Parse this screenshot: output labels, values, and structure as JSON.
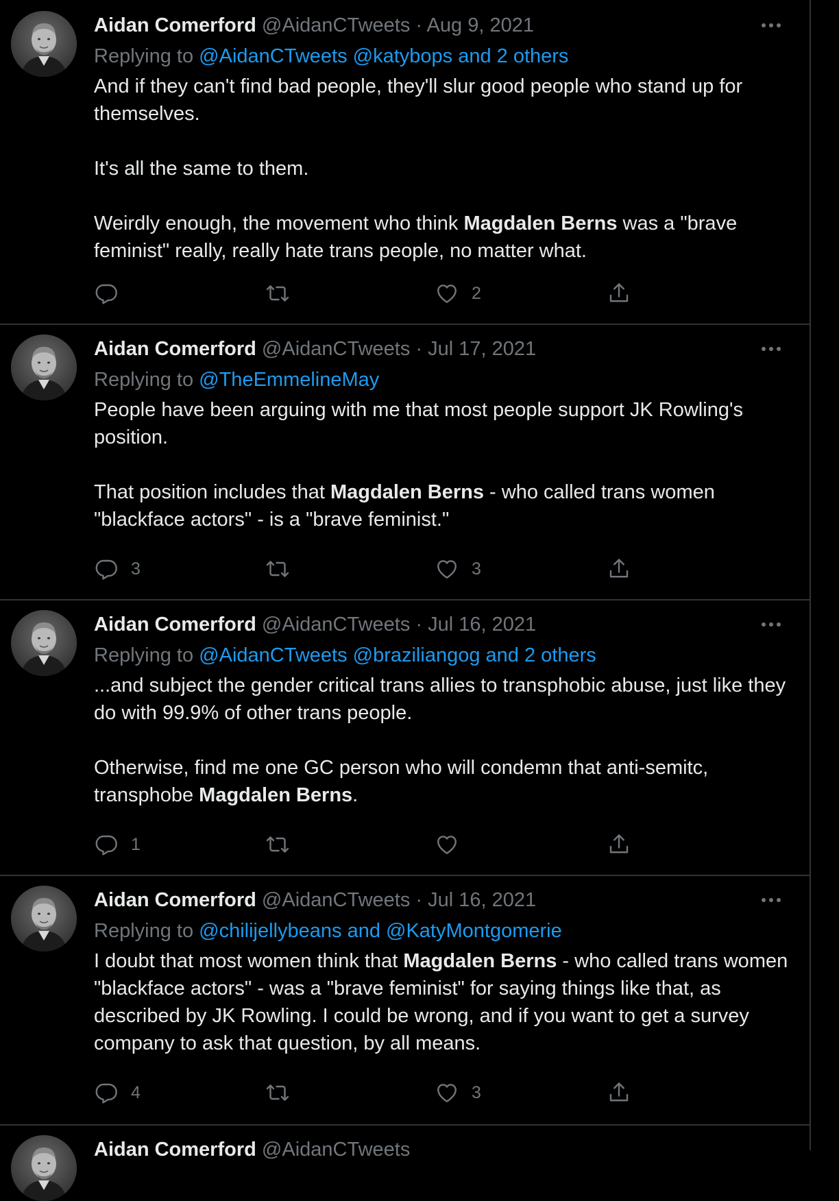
{
  "author": {
    "name": "Aidan Comerford",
    "handle": "@AidanCTweets"
  },
  "separator": "·",
  "replying_prefix": "Replying to",
  "tweets": [
    {
      "date": "Aug 9, 2021",
      "replying_to": "@AidanCTweets @katybops and 2 others",
      "paragraphs": [
        [
          "And if they can't find bad people, they'll slur good people who stand up for themselves."
        ],
        [
          "It's all the same to them."
        ],
        [
          "Weirdly enough, the movement who think ",
          "Magdalen Berns",
          " was a \"brave feminist\" really, really hate trans people, no matter what."
        ]
      ],
      "replies": "",
      "retweets": "",
      "likes": "2"
    },
    {
      "date": "Jul 17, 2021",
      "replying_to": "@TheEmmelineMay",
      "paragraphs": [
        [
          "People have been arguing with me that most people support JK Rowling's position."
        ],
        [
          "That position includes that ",
          "Magdalen Berns",
          " - who called trans women \"blackface actors\" - is a \"brave feminist.\""
        ]
      ],
      "replies": "3",
      "retweets": "",
      "likes": "3"
    },
    {
      "date": "Jul 16, 2021",
      "replying_to": "@AidanCTweets @braziliangog and 2 others",
      "paragraphs": [
        [
          "...and subject the gender critical trans allies to transphobic abuse, just like they do with 99.9% of other trans people."
        ],
        [
          "Otherwise, find me one GC person  who will condemn that anti-semitc, transphobe ",
          "Magdalen Berns",
          "."
        ]
      ],
      "replies": "1",
      "retweets": "",
      "likes": ""
    },
    {
      "date": "Jul 16, 2021",
      "replying_to": "@chilijellybeans and @KatyMontgomerie",
      "paragraphs": [
        [
          "I doubt that most women think that ",
          "Magdalen Berns",
          " - who called trans women \"blackface actors\" - was a \"brave feminist\" for saying things like that, as described by JK Rowling. I could be wrong, and if you want to get a survey company to ask that question, by all means."
        ]
      ],
      "replies": "4",
      "retweets": "",
      "likes": "3"
    }
  ],
  "icons": {
    "reply": "reply-icon",
    "retweet": "retweet-icon",
    "like": "heart-icon",
    "share": "share-icon",
    "more": "more-icon"
  },
  "colors": {
    "background": "#000000",
    "text": "#e7e9ea",
    "muted": "#71767b",
    "link": "#1d9bf0",
    "border": "#2f3336"
  }
}
